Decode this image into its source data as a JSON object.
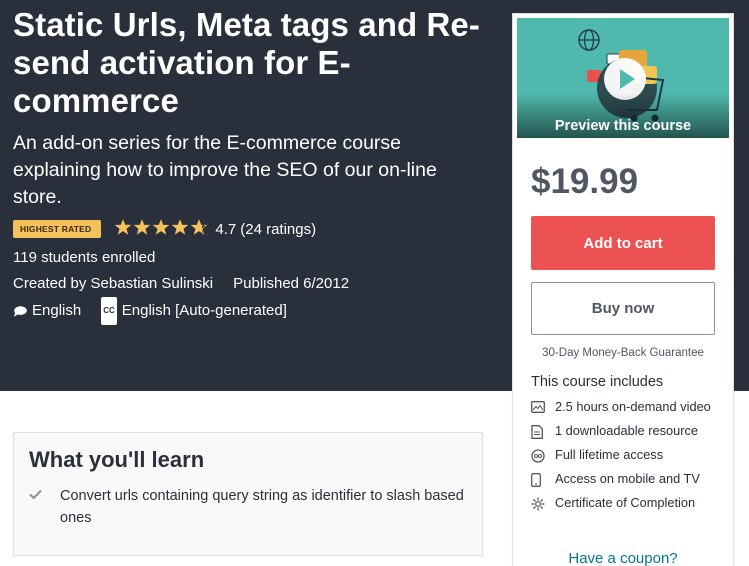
{
  "course": {
    "title": "Static Urls, Meta tags and Re-send activation for E-commerce",
    "subtitle": "An add-on series for the E-commerce course explaining how to improve the SEO of our on-line store.",
    "badge": "HIGHEST RATED",
    "rating": "4.7",
    "stars": 4.7,
    "rating_count": "(24 ratings)",
    "students": "119 students enrolled",
    "created_by": "Created by Sebastian Sulinski",
    "published": "Published 6/2012",
    "language": "English",
    "captions_icon": "CC",
    "captions": "English [Auto-generated]"
  },
  "sidebar": {
    "preview_label": "Preview this course",
    "price": "$19.99",
    "add_to_cart": "Add to cart",
    "buy_now": "Buy now",
    "guarantee": "30-Day Money-Back Guarantee",
    "includes_title": "This course includes",
    "includes": [
      {
        "icon": "video-icon",
        "text": "2.5 hours on-demand video"
      },
      {
        "icon": "file-icon",
        "text": "1 downloadable resource"
      },
      {
        "icon": "infinity-icon",
        "text": "Full lifetime access"
      },
      {
        "icon": "mobile-icon",
        "text": "Access on mobile and TV"
      },
      {
        "icon": "certificate-icon",
        "text": "Certificate of Completion"
      }
    ],
    "coupon": "Have a coupon?"
  },
  "learn": {
    "title": "What you'll learn",
    "items": [
      "Convert urls containing query string as identifier to slash based ones"
    ]
  },
  "colors": {
    "hero_bg": "#29303b",
    "accent_red": "#ec5252",
    "star_gold": "#f4c15d",
    "link_blue": "#007791",
    "preview_teal": "#4fb9ad"
  }
}
